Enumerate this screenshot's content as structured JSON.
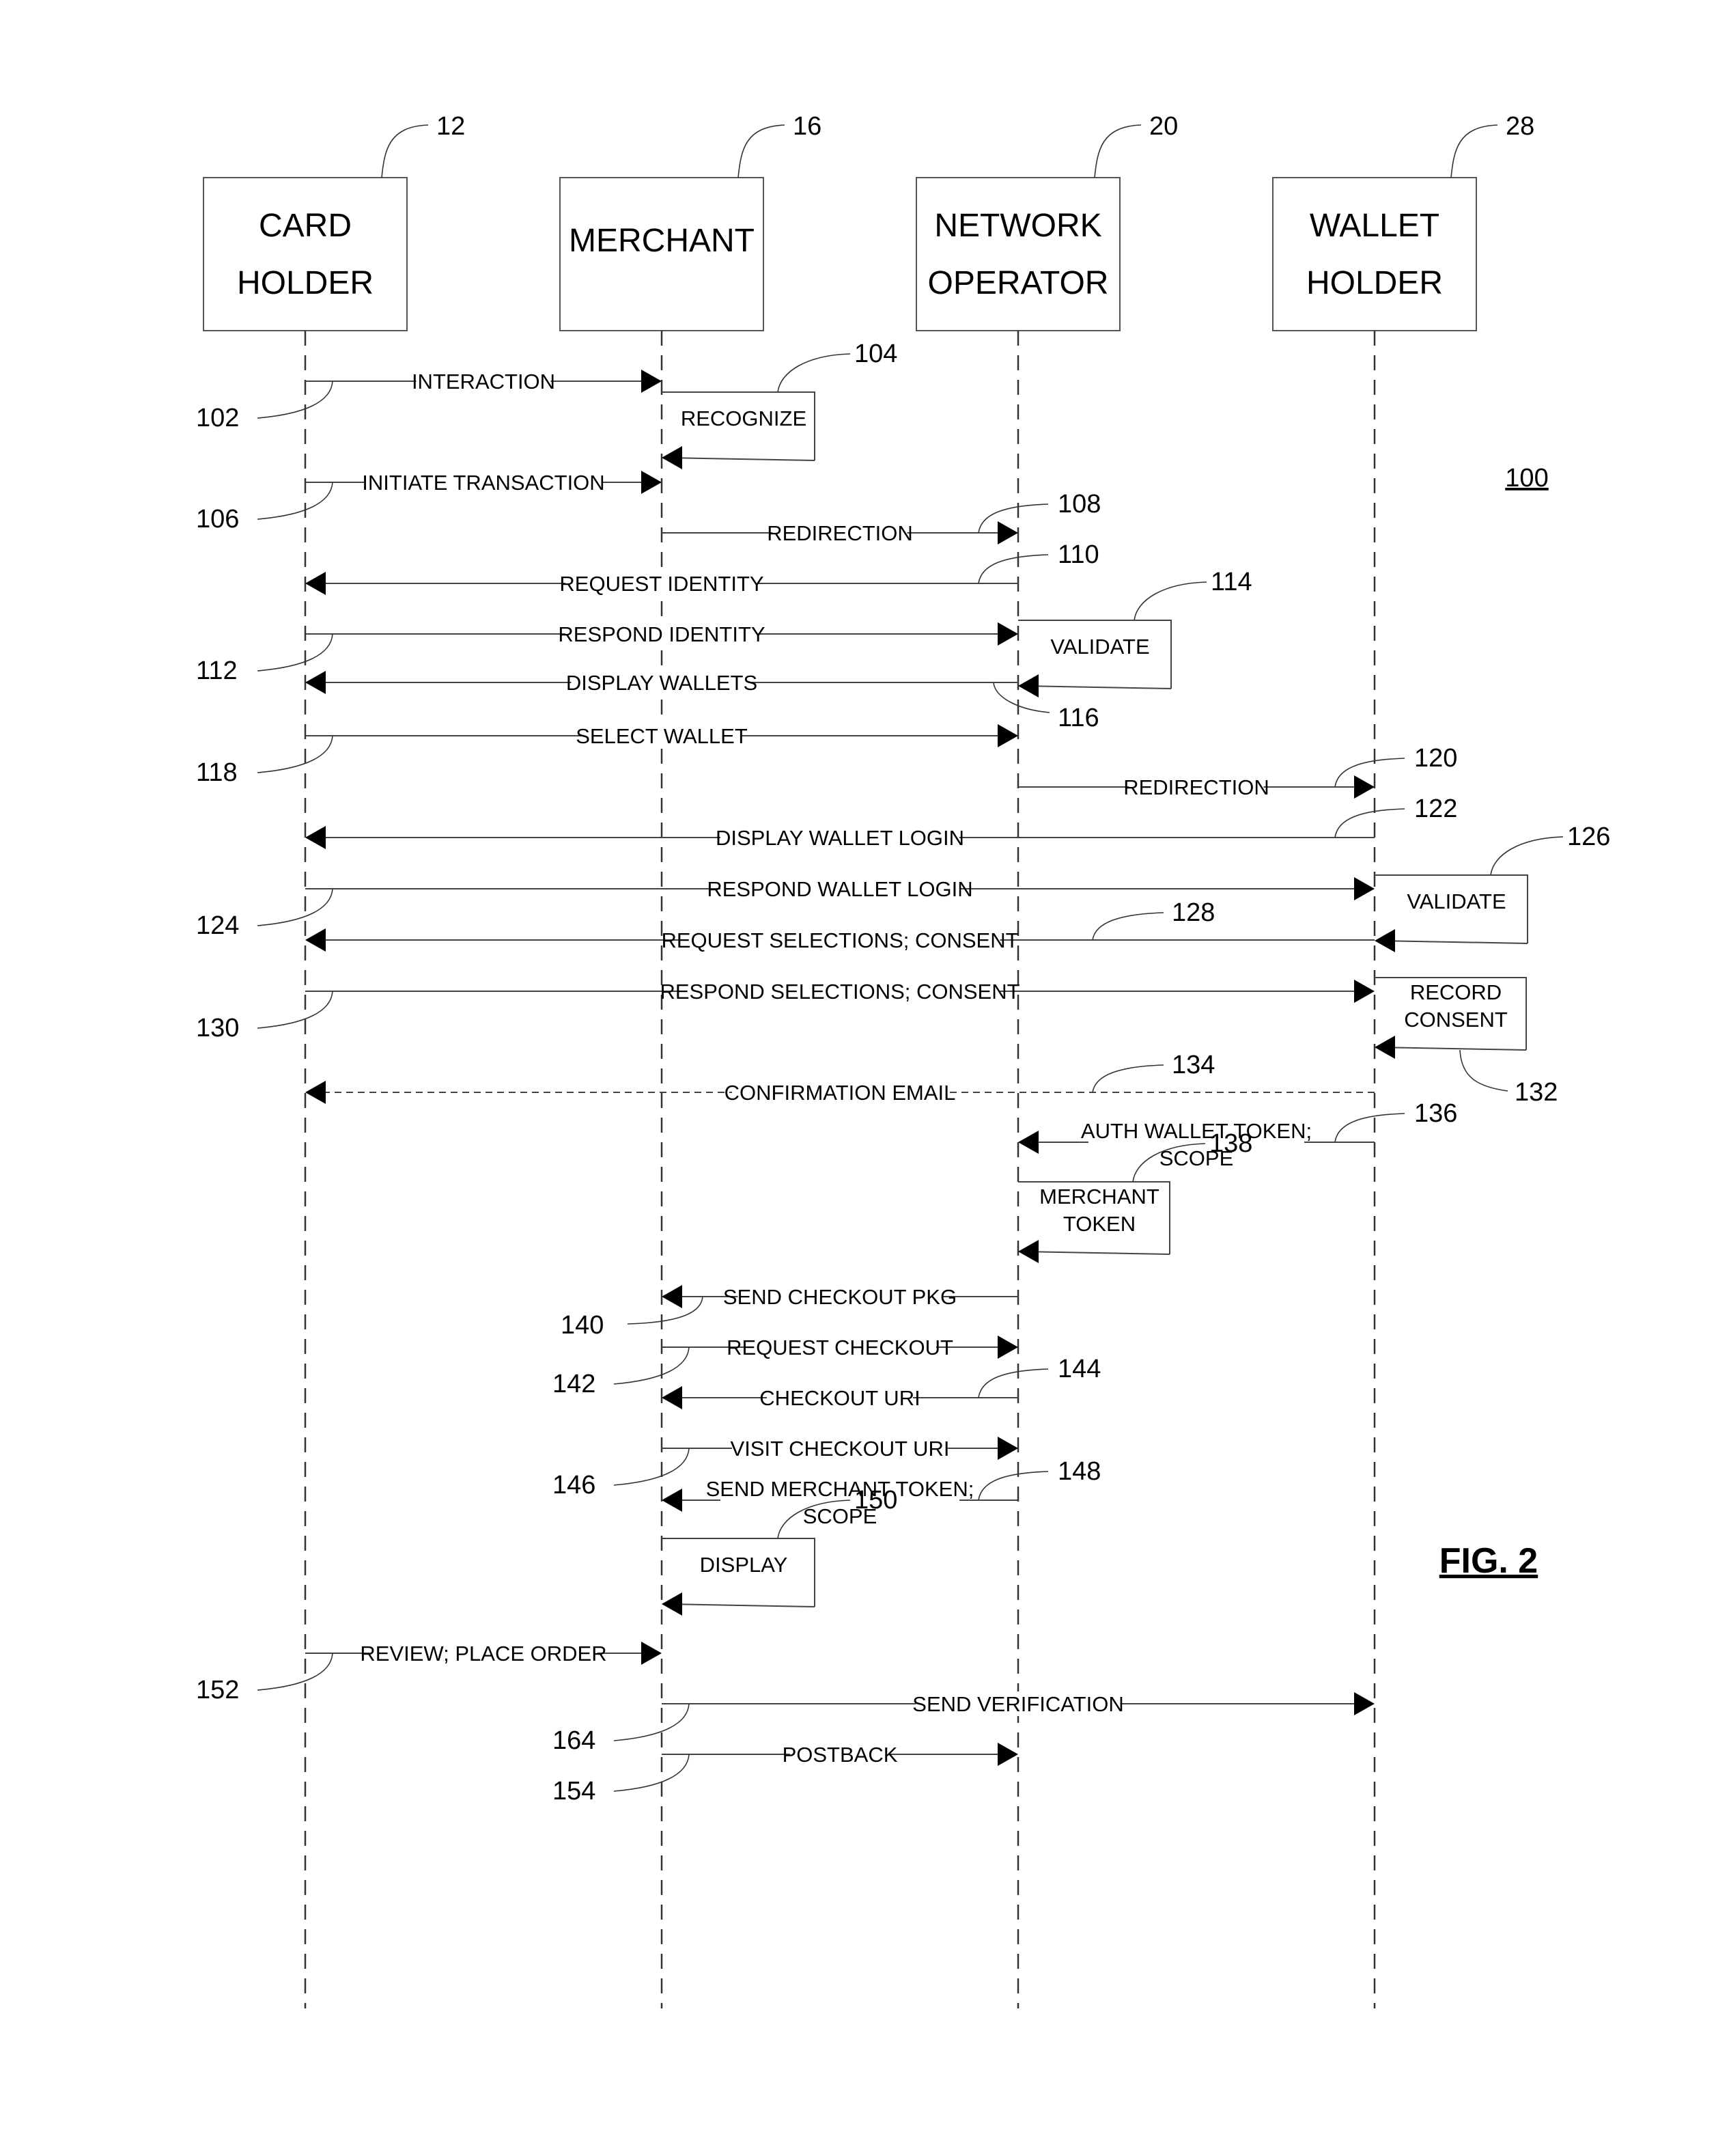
{
  "figure": {
    "title": "FIG. 2",
    "diagram_ref": "100"
  },
  "actors": [
    {
      "id": "card_holder",
      "lines": [
        "CARD",
        "HOLDER"
      ],
      "ref": "12"
    },
    {
      "id": "merchant",
      "lines": [
        "MERCHANT"
      ],
      "ref": "16"
    },
    {
      "id": "network_operator",
      "lines": [
        "NETWORK",
        "OPERATOR"
      ],
      "ref": "20"
    },
    {
      "id": "wallet_holder",
      "lines": [
        "WALLET",
        "HOLDER"
      ],
      "ref": "28"
    }
  ],
  "messages": [
    {
      "ref": "102",
      "label": [
        "INTERACTION"
      ],
      "from": 0,
      "to": 1,
      "style": "solid"
    },
    {
      "ref": "104",
      "label": [
        "RECOGNIZE"
      ],
      "self": 1,
      "style": "solid"
    },
    {
      "ref": "106",
      "label": [
        "INITIATE TRANSACTION"
      ],
      "from": 0,
      "to": 1,
      "style": "solid"
    },
    {
      "ref": "108",
      "label": [
        "REDIRECTION"
      ],
      "from": 1,
      "to": 2,
      "style": "solid"
    },
    {
      "ref": "110",
      "label": [
        "REQUEST IDENTITY"
      ],
      "from": 2,
      "to": 0,
      "style": "solid"
    },
    {
      "ref": "112",
      "label": [
        "RESPOND IDENTITY"
      ],
      "from": 0,
      "to": 2,
      "style": "solid"
    },
    {
      "ref": "114",
      "label": [
        "VALIDATE"
      ],
      "self": 2,
      "style": "solid"
    },
    {
      "ref": "116",
      "label": [
        "DISPLAY WALLETS"
      ],
      "from": 2,
      "to": 0,
      "style": "solid"
    },
    {
      "ref": "118",
      "label": [
        "SELECT WALLET"
      ],
      "from": 0,
      "to": 2,
      "style": "solid"
    },
    {
      "ref": "120",
      "label": [
        "REDIRECTION"
      ],
      "from": 2,
      "to": 3,
      "style": "solid"
    },
    {
      "ref": "122",
      "label": [
        "DISPLAY WALLET LOGIN"
      ],
      "from": 3,
      "to": 0,
      "style": "solid"
    },
    {
      "ref": "124",
      "label": [
        "RESPOND WALLET LOGIN"
      ],
      "from": 0,
      "to": 3,
      "style": "solid"
    },
    {
      "ref": "126",
      "label": [
        "VALIDATE"
      ],
      "self": 3,
      "style": "solid"
    },
    {
      "ref": "128",
      "label": [
        "REQUEST SELECTIONS; CONSENT"
      ],
      "from": 3,
      "to": 0,
      "style": "solid"
    },
    {
      "ref": "130",
      "label": [
        "RESPOND SELECTIONS; CONSENT"
      ],
      "from": 0,
      "to": 3,
      "style": "solid"
    },
    {
      "ref": "132",
      "label": [
        "RECORD",
        "CONSENT"
      ],
      "self": 3,
      "style": "solid"
    },
    {
      "ref": "134",
      "label": [
        "CONFIRMATION EMAIL"
      ],
      "from": 3,
      "to": 0,
      "style": "dashed"
    },
    {
      "ref": "136",
      "label": [
        "AUTH WALLET TOKEN;",
        "SCOPE"
      ],
      "from": 3,
      "to": 2,
      "style": "solid"
    },
    {
      "ref": "138",
      "label": [
        "MERCHANT",
        "TOKEN"
      ],
      "self": 2,
      "style": "solid"
    },
    {
      "ref": "140",
      "label": [
        "SEND CHECKOUT PKG"
      ],
      "from": 2,
      "to": 1,
      "style": "solid"
    },
    {
      "ref": "142",
      "label": [
        "REQUEST CHECKOUT"
      ],
      "from": 1,
      "to": 2,
      "style": "solid"
    },
    {
      "ref": "144",
      "label": [
        "CHECKOUT URI"
      ],
      "from": 2,
      "to": 1,
      "style": "solid"
    },
    {
      "ref": "146",
      "label": [
        "VISIT CHECKOUT URI"
      ],
      "from": 1,
      "to": 2,
      "style": "solid"
    },
    {
      "ref": "148",
      "label": [
        "SEND MERCHANT TOKEN;",
        "SCOPE"
      ],
      "from": 2,
      "to": 1,
      "style": "solid"
    },
    {
      "ref": "150",
      "label": [
        "DISPLAY"
      ],
      "self": 1,
      "style": "solid"
    },
    {
      "ref": "152",
      "label": [
        "REVIEW; PLACE ORDER"
      ],
      "from": 0,
      "to": 1,
      "style": "solid"
    },
    {
      "ref": "164",
      "label": [
        "SEND VERIFICATION"
      ],
      "from": 1,
      "to": 3,
      "style": "solid"
    },
    {
      "ref": "154",
      "label": [
        "POSTBACK"
      ],
      "from": 1,
      "to": 2,
      "style": "solid"
    }
  ]
}
